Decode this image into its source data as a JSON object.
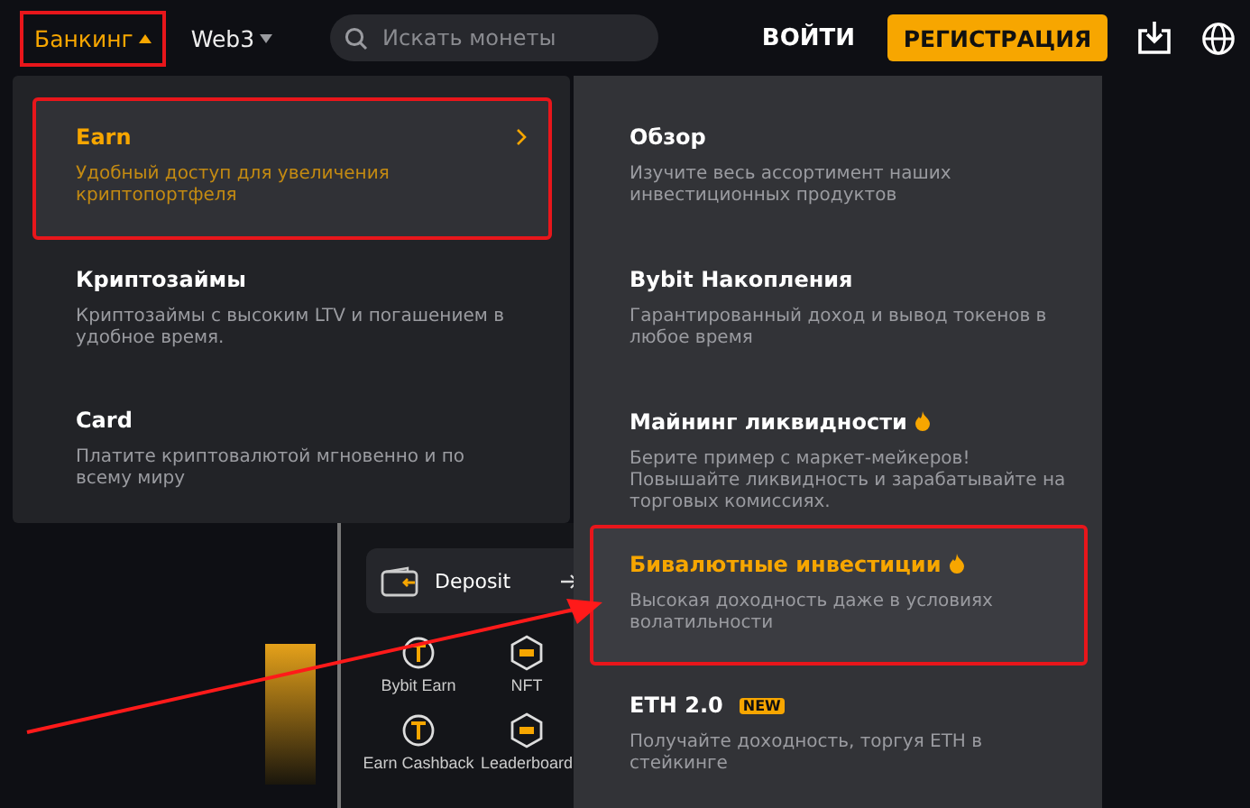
{
  "nav": {
    "items": [
      {
        "label": "Банкинг",
        "selected": true,
        "annotated": true
      },
      {
        "label": "Web3",
        "selected": false,
        "annotated": false
      }
    ],
    "search": {
      "placeholder": "Искать монеты"
    },
    "login": "ВОЙТИ",
    "register": "РЕГИСТРАЦИЯ"
  },
  "left_menu": {
    "items": [
      {
        "title": "Earn",
        "description": "Удобный доступ для увеличения криптопортфеля",
        "selected": true,
        "annotated": true
      },
      {
        "title": "Криптозаймы",
        "description": "Криптозаймы с высоким LTV и погашением в удобное время.",
        "selected": false,
        "annotated": false
      },
      {
        "title": "Card",
        "description": "Платите криптовалютой мгновенно и по всему миру",
        "selected": false,
        "annotated": false
      }
    ]
  },
  "right_menu": {
    "items": [
      {
        "title": "Обзор",
        "description": "Изучите весь ассортимент наших инвестиционных продуктов",
        "selected": false,
        "annotated": false,
        "hot": false
      },
      {
        "title": "Bybit Накопления",
        "description": "Гарантированный доход и вывод токенов в любое время",
        "selected": false,
        "annotated": false,
        "hot": false
      },
      {
        "title": "Майнинг ликвидности",
        "description": "Берите пример с маркет-мейкеров! Повышайте ликвидность и зарабатывайте на торговых комиссиях.",
        "selected": false,
        "annotated": false,
        "hot": true
      },
      {
        "title": "Бивалютные инвестиции",
        "description": "Высокая доходность даже в условиях волатильности",
        "selected": true,
        "annotated": true,
        "hot": true
      },
      {
        "title": "ETH 2.0",
        "badge": "NEW",
        "description": "Получайте доходность, торгуя ETH в стейкинге",
        "selected": false,
        "annotated": false,
        "hot": false
      }
    ]
  },
  "background_app": {
    "deposit": "Deposit",
    "shortcuts": [
      "Bybit Earn",
      "NFT",
      "Earn Cashback",
      "Leaderboard"
    ]
  }
}
